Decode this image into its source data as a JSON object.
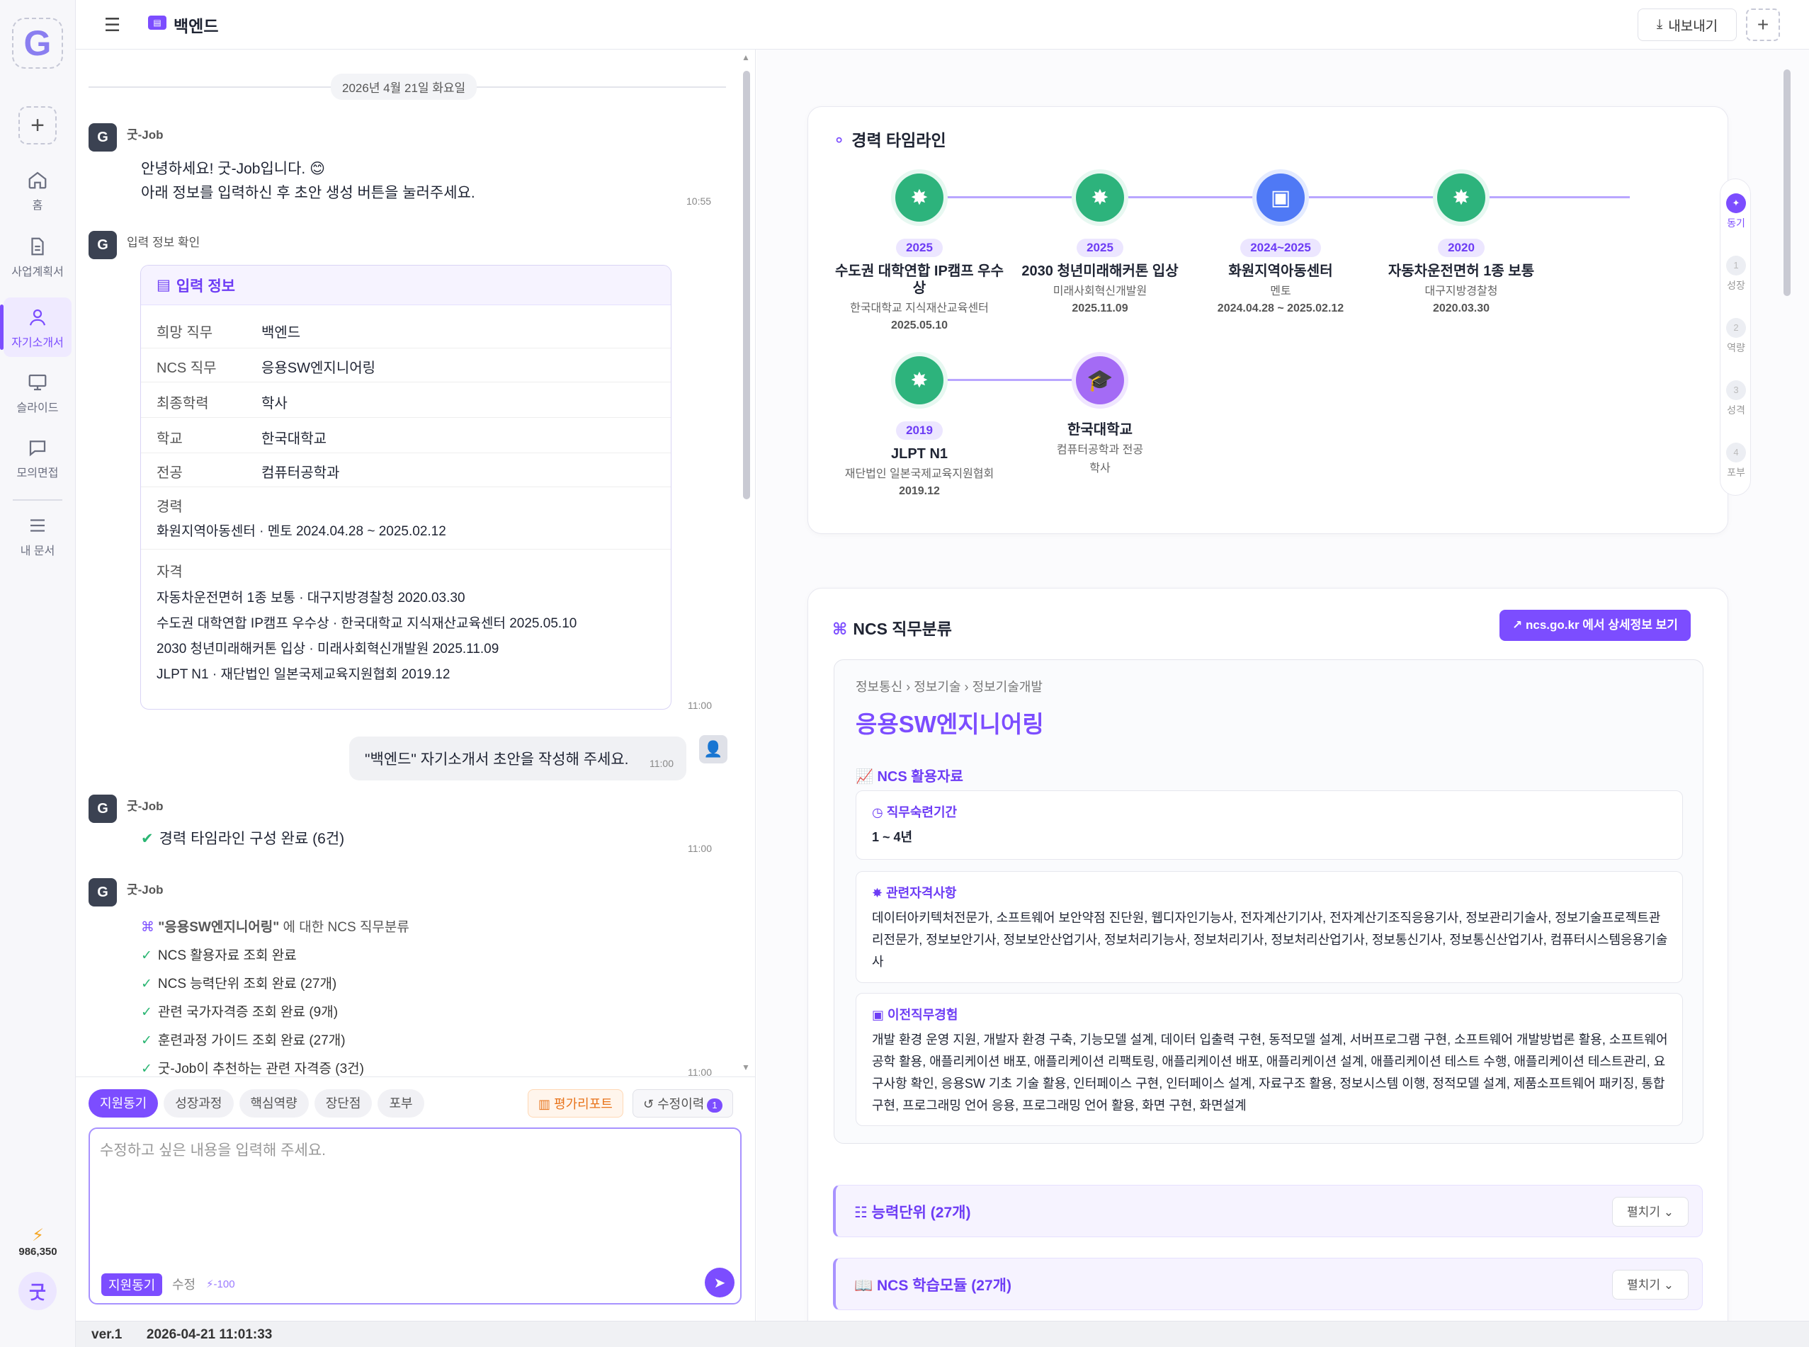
{
  "rail": {
    "logo": "G",
    "nav": [
      {
        "label": "홈",
        "icon": "home-icon"
      },
      {
        "label": "사업계획서",
        "icon": "document-icon"
      },
      {
        "label": "자기소개서",
        "icon": "person-icon"
      },
      {
        "label": "슬라이드",
        "icon": "monitor-icon"
      },
      {
        "label": "모의면접",
        "icon": "chat-icon"
      },
      {
        "label": "내 문서",
        "icon": "list-icon"
      }
    ],
    "points": "986,350",
    "avatar": "굿"
  },
  "topbar": {
    "title": "백엔드",
    "export_label": "내보내기"
  },
  "chat": {
    "date": "2026년 4월 21일 화요일",
    "sender": "굿-Job",
    "greeting_line1": "안녕하세요! 굿-Job입니다. 😊",
    "greeting_line2": "아래 정보를 입력하신 후 초안 생성 버튼을 눌러주세요.",
    "greeting_time": "10:55",
    "confirm_label": "입력 정보 확인",
    "card_title": "입력 정보",
    "fields": [
      {
        "label": "희망 직무",
        "value": "백엔드"
      },
      {
        "label": "NCS 직무",
        "value": "응용SW엔지니어링"
      },
      {
        "label": "최종학력",
        "value": "학사"
      },
      {
        "label": "학교",
        "value": "한국대학교"
      },
      {
        "label": "전공",
        "value": "컴퓨터공학과"
      }
    ],
    "career_label": "경력",
    "career_value": "화원지역아동센터 · 멘토 2024.04.28 ~ 2025.02.12",
    "cert_label": "자격",
    "certs": [
      "자동차운전면허 1종 보통 · 대구지방경찰청 2020.03.30",
      "수도권 대학연합 IP캠프 우수상 · 한국대학교 지식재산교육센터 2025.05.10",
      "2030 청년미래해커톤 입상 · 미래사회혁신개발원 2025.11.09",
      "JLPT N1 · 재단법인 일본국제교육지원협회 2019.12"
    ],
    "card_time": "11:00",
    "user_msg": "\"백엔드\" 자기소개서 초안을 작성해 주세요.",
    "user_time": "11:00",
    "timeline_done": "경력 타임라인 구성 완료 (6건)",
    "timeline_time": "11:00",
    "ncs_intro_job": "\"응용SW엔지니어링\"",
    "ncs_intro_rest": "에 대한 NCS 직무분류",
    "checks": [
      "NCS 활용자료 조회 완료",
      "NCS 능력단위 조회 완료 (27개)",
      "관련 국가자격증 조회 완료 (9개)",
      "훈련과정 가이드 조회 완료 (27개)",
      "굿-Job이 추천하는 관련 자격증 (3건)"
    ],
    "checks_time": "11:00"
  },
  "composer": {
    "tabs": [
      "지원동기",
      "성장과정",
      "핵심역량",
      "장단점",
      "포부"
    ],
    "eval_label": "평가리포트",
    "history_label": "수정이력",
    "history_count": "1",
    "placeholder": "수정하고 싶은 내용을 입력해 주세요.",
    "mode": "지원동기",
    "mode_action": "수정",
    "cost": "-100"
  },
  "status": {
    "version": "ver.1",
    "timestamp": "2026-04-21 11:01:33"
  },
  "timeline": {
    "title": "경력 타임라인",
    "nodes": [
      {
        "year": "2025",
        "name": "수도권 대학연합 IP캠프 우수상",
        "org": "한국대학교 지식재산교육센터",
        "date": "2025.05.10",
        "type": "green"
      },
      {
        "year": "2025",
        "name": "2030 청년미래해커톤 입상",
        "org": "미래사회혁신개발원",
        "date": "2025.11.09",
        "type": "green"
      },
      {
        "year": "2024~2025",
        "name": "화원지역아동센터",
        "org": "멘토",
        "date": "2024.04.28 ~ 2025.02.12",
        "type": "blue"
      },
      {
        "year": "2020",
        "name": "자동차운전면허 1종 보통",
        "org": "대구지방경찰청",
        "date": "2020.03.30",
        "type": "green"
      },
      {
        "year": "2019",
        "name": "JLPT N1",
        "org": "재단법인 일본국제교육지원협회",
        "date": "2019.12",
        "type": "green"
      },
      {
        "year": "",
        "name": "한국대학교",
        "org": "컴퓨터공학과 전공",
        "date": "학사",
        "type": "purple"
      }
    ]
  },
  "steps": [
    {
      "n": "✦",
      "label": "동기"
    },
    {
      "n": "1",
      "label": "성장"
    },
    {
      "n": "2",
      "label": "역량"
    },
    {
      "n": "3",
      "label": "성격"
    },
    {
      "n": "4",
      "label": "포부"
    }
  ],
  "ncs": {
    "title": "NCS 직무분류",
    "link_label": "ncs.go.kr 에서 상세정보 보기",
    "breadcrumb": [
      "정보통신",
      "정보기술",
      "정보기술개발"
    ],
    "job": "응용SW엔지니어링",
    "resources_title": "NCS 활용자료",
    "period_title": "직무숙련기간",
    "period_value": "1 ~ 4년",
    "certs_title": "관련자격사항",
    "certs_value": "데이터아키텍처전문가, 소프트웨어 보안약점 진단원, 웹디자인기능사, 전자계산기기사, 전자계산기조직응용기사, 정보관리기술사, 정보기술프로젝트관리전문가, 정보보안기사, 정보보안산업기사, 정보처리기능사, 정보처리기사, 정보처리산업기사, 정보통신기사, 정보통신산업기사, 컴퓨터시스템응용기술사",
    "transfer_title": "이전직무경험",
    "transfer_value": "개발 환경 운영 지원, 개발자 환경 구축, 기능모델 설계, 데이터 입출력 구현, 동적모델 설계, 서버프로그램 구현, 소프트웨어 개발방법론 활용, 소프트웨어공학 활용, 애플리케이션 배포, 애플리케이션 리팩토링, 애플리케이션 배포, 애플리케이션 설계, 애플리케이션 테스트 수행, 애플리케이션 테스트관리, 요구사항 확인, 응용SW 기초 기술 활용, 인터페이스 구현, 인터페이스 설계, 자료구조 활용, 정보시스템 이행, 정적모델 설계, 제품소프트웨어 패키징, 통합 구현, 프로그래밍 언어 응용, 프로그래밍 언어 활용, 화면 구현, 화면설계",
    "units_label": "능력단위 (27개)",
    "modules_label": "NCS 학습모듈 (27개)",
    "expand_label": "펼치기"
  }
}
